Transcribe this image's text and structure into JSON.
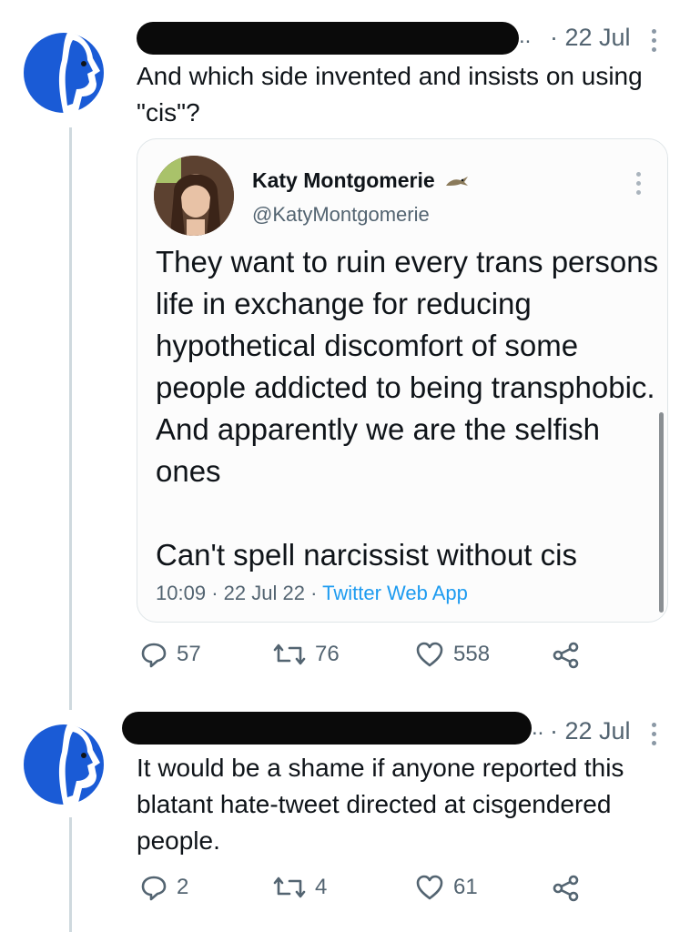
{
  "tweet1": {
    "date": "· 22 Jul",
    "text": "And which side invented and insists on using \"cis\"?",
    "actions": {
      "replies": "57",
      "retweets": "76",
      "likes": "558"
    }
  },
  "quote": {
    "name": "Katy Montgomerie",
    "handle": "@KatyMontgomerie",
    "paragraph1": "They want to ruin every trans persons life in exchange for reducing hypothetical discomfort of some people addicted to being transphobic. And apparently we are the selfish ones",
    "paragraph2": "Can't spell narcissist without cis",
    "time": "10:09",
    "date": "22 Jul 22",
    "app": "Twitter Web App"
  },
  "tweet2": {
    "date": "· 22 Jul",
    "text": "It would be a shame if anyone reported this blatant hate-tweet directed at cisgendered people.",
    "actions": {
      "replies": "2",
      "retweets": "4",
      "likes": "61"
    }
  },
  "colors": {
    "avatar_blue": "#1a5bd6",
    "link_blue": "#1d9bf0",
    "muted": "#536471"
  },
  "icons": [
    "profile-logo-icon",
    "more-dots-icon",
    "reply-icon",
    "retweet-icon",
    "like-icon",
    "share-icon",
    "verified-lizard-icon"
  ]
}
